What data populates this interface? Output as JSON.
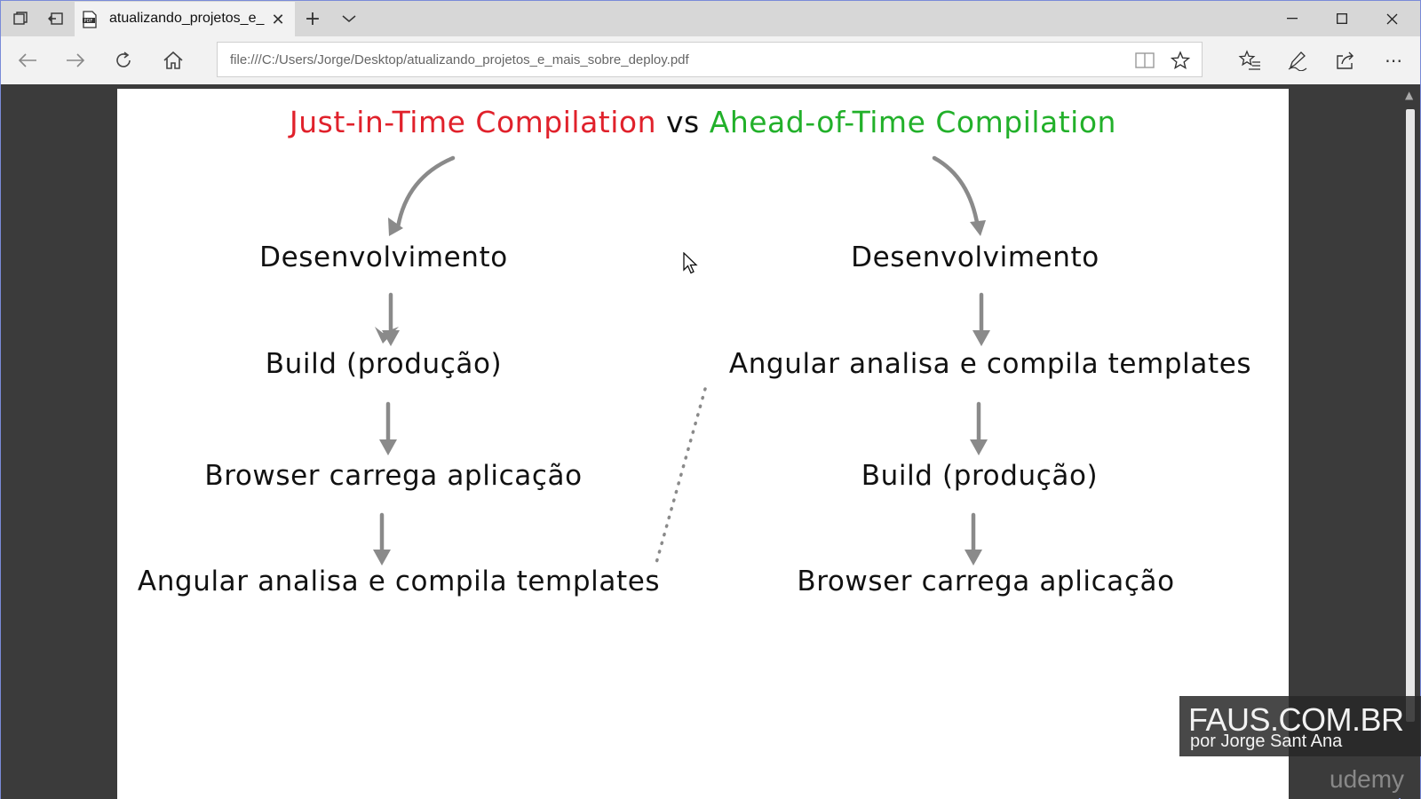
{
  "browser": {
    "tab_title": "atualizando_projetos_e_",
    "url": "file:///C:/Users/Jorge/Desktop/atualizando_projetos_e_mais_sobre_deploy.pdf",
    "accent": "#7a8bd8"
  },
  "slide": {
    "title_jit": "Just-in-Time Compilation",
    "title_vs": "vs",
    "title_aot": "Ahead-of-Time Compilation",
    "jit_color": "#e0212b",
    "aot_color": "#22b02a",
    "jit_steps": [
      "Desenvolvimento",
      "Build (produção)",
      "Browser carrega aplicação",
      "Angular analisa e compila templates"
    ],
    "aot_steps": [
      "Desenvolvimento",
      "Angular analisa e compila templates",
      "Build (produção)",
      "Browser carrega aplicação"
    ]
  },
  "watermark": {
    "brand": "FAUS.COM.BR",
    "author": "por Jorge Sant Ana",
    "platform": "udemy"
  }
}
